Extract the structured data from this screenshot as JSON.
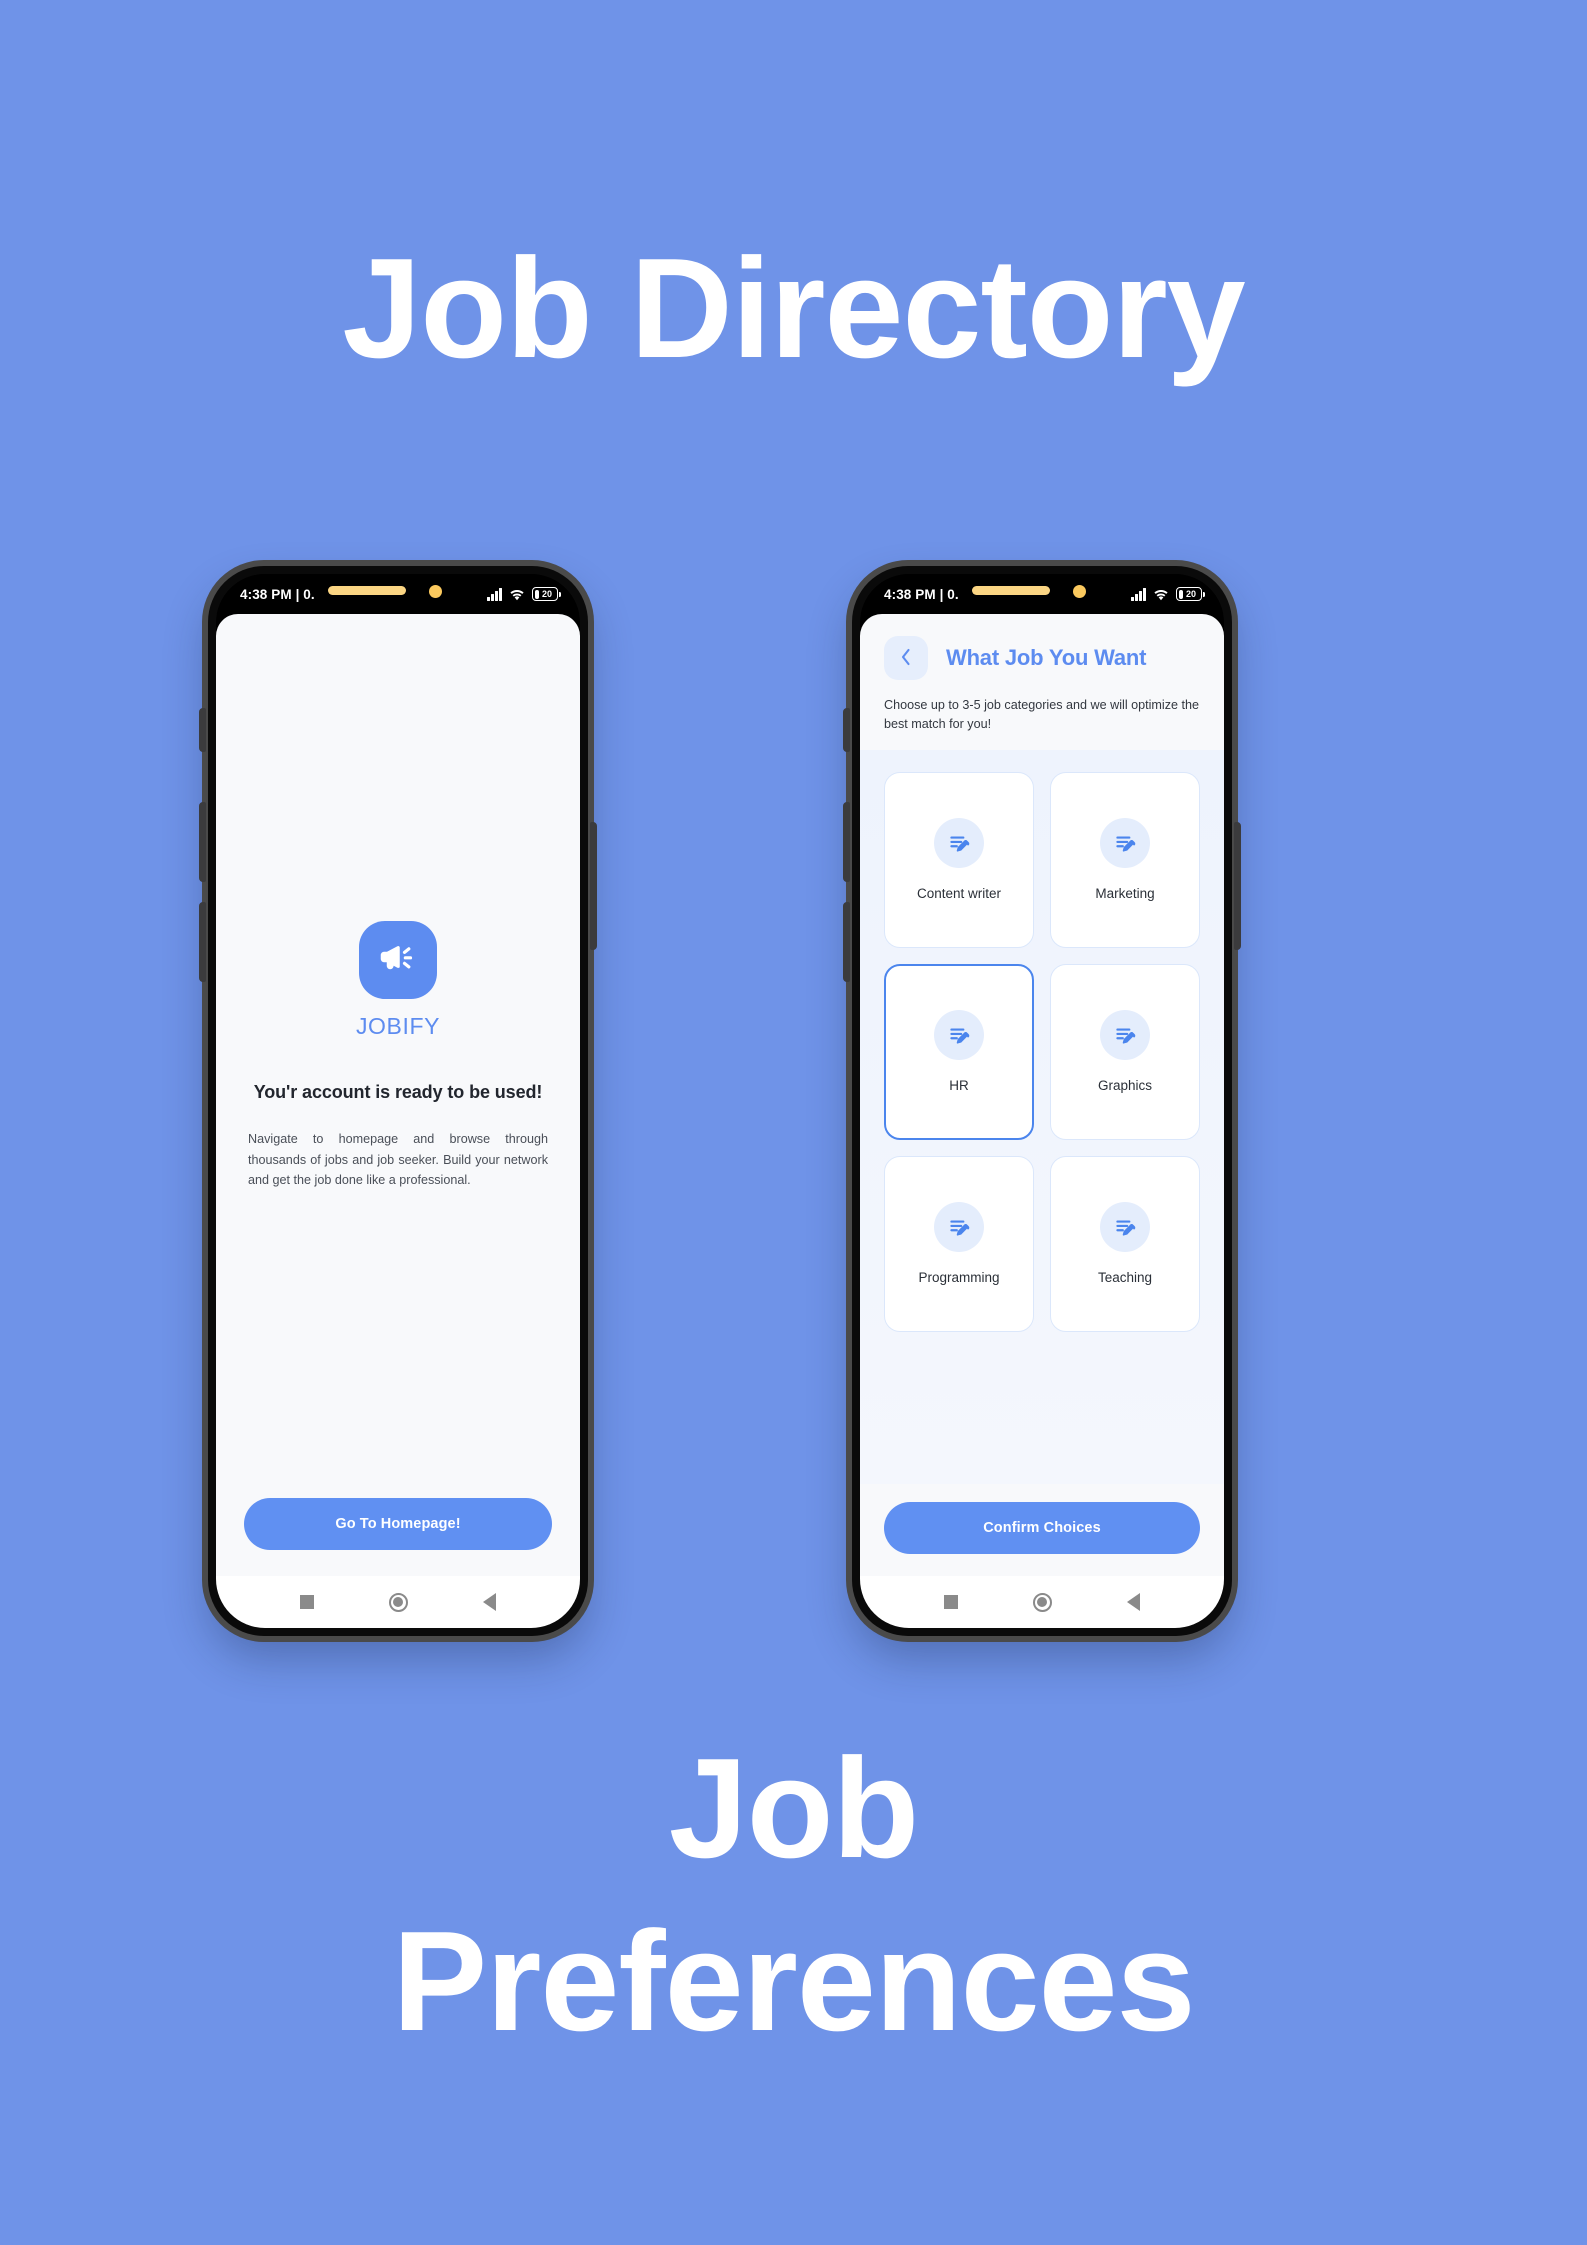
{
  "poster": {
    "title": "Job Directory",
    "bottom_lines": [
      "Job",
      "Preferences"
    ],
    "background_color": "#6f93e8",
    "accent_color": "#5d8cf0"
  },
  "status_bar": {
    "clock": "4:38 PM | 0.",
    "battery_level": "20",
    "icons": [
      "signal-icon",
      "wifi-icon",
      "battery-icon"
    ]
  },
  "nav_bar": {
    "recents": "recents-square-icon",
    "home": "home-circle-icon",
    "back": "back-triangle-icon"
  },
  "screen_one": {
    "name": "account-ready-screen",
    "logo_icon": "megaphone-icon",
    "brand": "JOBIFY",
    "headline": "You'r account is ready to be used!",
    "paragraph": "Navigate to homepage and browse through thousands of jobs and job seeker. Build your network and get the job done like a professional.",
    "cta_label": "Go To Homepage!"
  },
  "screen_two": {
    "name": "job-preferences-screen",
    "back_icon": "chevron-left-icon",
    "title": "What Job You Want",
    "subtitle": "Choose up to 3-5 job categories and we will optimize the best match for you!",
    "cta_label": "Confirm Choices",
    "categories": [
      {
        "label": "Content writer",
        "icon": "document-edit-icon",
        "selected": false
      },
      {
        "label": "Marketing",
        "icon": "document-edit-icon",
        "selected": false
      },
      {
        "label": "HR",
        "icon": "document-edit-icon",
        "selected": true
      },
      {
        "label": "Graphics",
        "icon": "document-edit-icon",
        "selected": false
      },
      {
        "label": "Programming",
        "icon": "document-edit-icon",
        "selected": false
      },
      {
        "label": "Teaching",
        "icon": "document-edit-icon",
        "selected": false
      }
    ]
  }
}
